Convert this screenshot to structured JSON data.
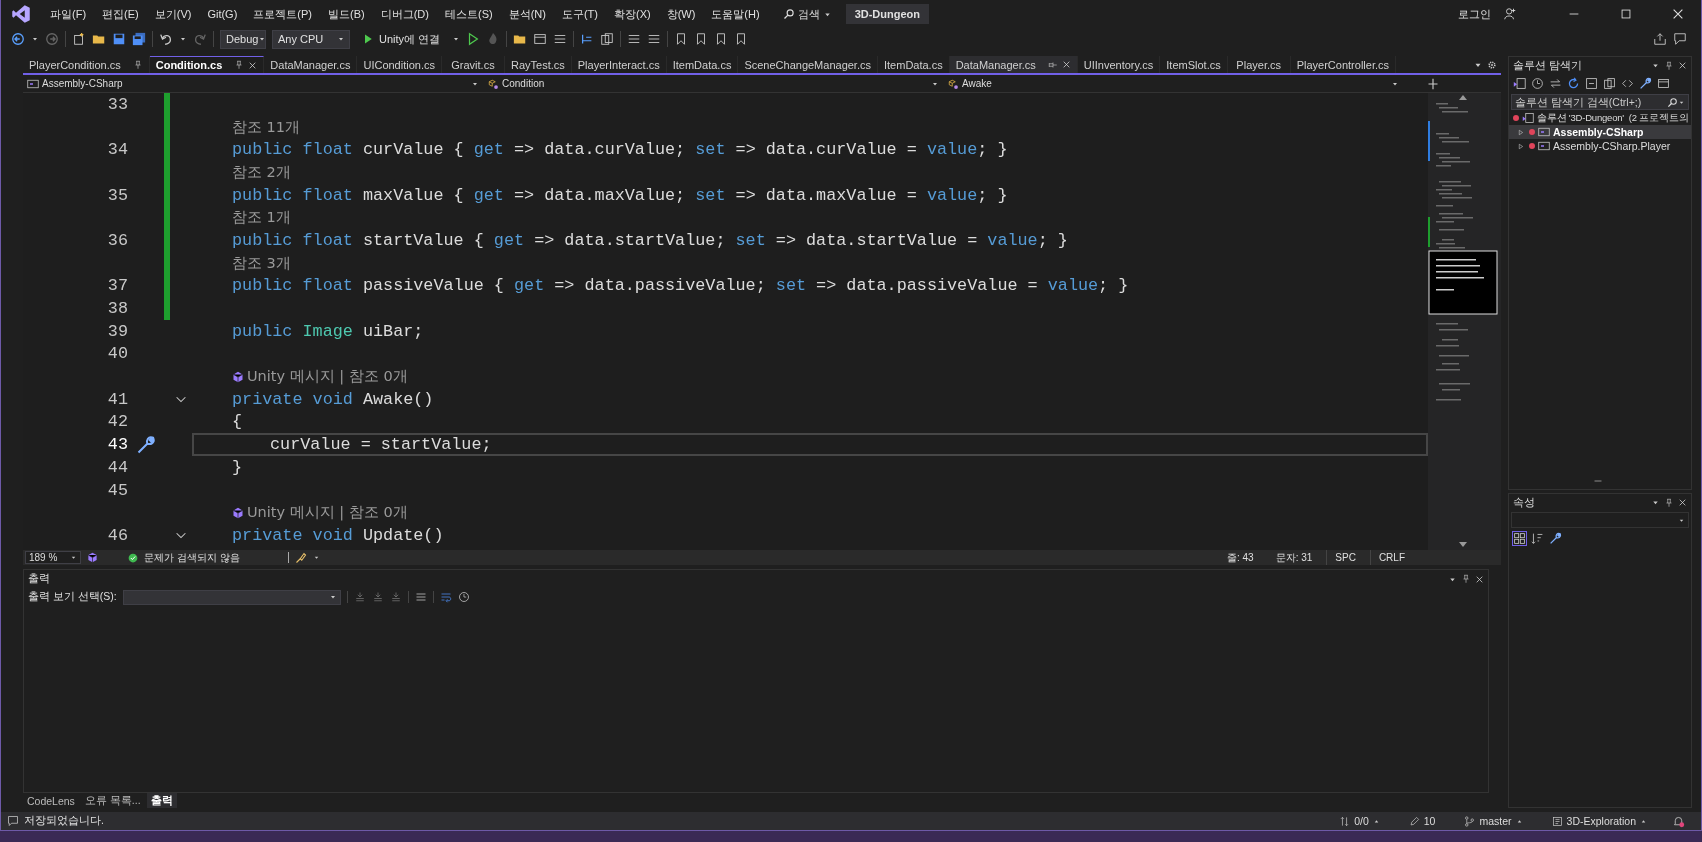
{
  "title_bar": {
    "menu": [
      "파일(F)",
      "편집(E)",
      "보기(V)",
      "Git(G)",
      "프로젝트(P)",
      "빌드(B)",
      "디버그(D)",
      "테스트(S)",
      "분석(N)",
      "도구(T)",
      "확장(X)",
      "창(W)",
      "도움말(H)"
    ],
    "search": "검색",
    "solution_name": "3D-Dungeon",
    "sign_in": "로그인"
  },
  "toolbar": {
    "configuration": "Debug",
    "platform": "Any CPU",
    "run_target": "Unity에 연결"
  },
  "document_tabs": [
    {
      "label": "PlayerCondition.cs",
      "selected": false,
      "pinned": true,
      "hovered": false
    },
    {
      "label": "Condition.cs",
      "selected": true,
      "pinned": true,
      "hovered": false
    },
    {
      "label": "DataManager.cs",
      "selected": false,
      "pinned": false,
      "hovered": false
    },
    {
      "label": "UICondition.cs",
      "selected": false,
      "pinned": false,
      "hovered": false
    },
    {
      "label": "Gravit.cs",
      "selected": false,
      "pinned": false,
      "hovered": false
    },
    {
      "label": "RayTest.cs",
      "selected": false,
      "pinned": false,
      "hovered": false
    },
    {
      "label": "PlayerInteract.cs",
      "selected": false,
      "pinned": false,
      "hovered": false
    },
    {
      "label": "ItemData.cs",
      "selected": false,
      "pinned": false,
      "hovered": false
    },
    {
      "label": "SceneChangeManager.cs",
      "selected": false,
      "pinned": false,
      "hovered": false
    },
    {
      "label": "ItemData.cs",
      "selected": false,
      "pinned": false,
      "hovered": false
    },
    {
      "label": "DataManager.cs",
      "selected": false,
      "pinned": false,
      "hovered": true
    },
    {
      "label": "UIInventory.cs",
      "selected": false,
      "pinned": false,
      "hovered": false
    },
    {
      "label": "ItemSlot.cs",
      "selected": false,
      "pinned": false,
      "hovered": false
    },
    {
      "label": "Player.cs",
      "selected": false,
      "pinned": false,
      "hovered": false
    },
    {
      "label": "PlayerController.cs",
      "selected": false,
      "pinned": false,
      "hovered": false
    }
  ],
  "navigation_bar": {
    "project": "Assembly-CSharp",
    "type": "Condition",
    "member": "Awake"
  },
  "code_lines": [
    {
      "kind": "code",
      "number": "33",
      "changed": true,
      "current": false,
      "foldable": false,
      "nested": false,
      "quick_action": false
    },
    {
      "kind": "codelens",
      "text": "참조 11개",
      "changed": true,
      "unity": false
    },
    {
      "kind": "code",
      "number": "34",
      "changed": true,
      "current": false,
      "foldable": false,
      "nested": false,
      "quick_action": false,
      "tokens": [
        {
          "kind": "keyword",
          "text": "public float "
        },
        {
          "kind": "plain",
          "text": "curValue { "
        },
        {
          "kind": "keyword",
          "text": "get"
        },
        {
          "kind": "plain",
          "text": " => data.curValue; "
        },
        {
          "kind": "keyword",
          "text": "set"
        },
        {
          "kind": "plain",
          "text": " => data.curValue = "
        },
        {
          "kind": "keyword",
          "text": "value"
        },
        {
          "kind": "plain",
          "text": "; }"
        }
      ]
    },
    {
      "kind": "codelens",
      "text": "참조 2개",
      "changed": true,
      "unity": false
    },
    {
      "kind": "code",
      "number": "35",
      "changed": true,
      "current": false,
      "foldable": false,
      "nested": false,
      "quick_action": false,
      "tokens": [
        {
          "kind": "keyword",
          "text": "public float "
        },
        {
          "kind": "plain",
          "text": "maxValue { "
        },
        {
          "kind": "keyword",
          "text": "get"
        },
        {
          "kind": "plain",
          "text": " => data.maxValue; "
        },
        {
          "kind": "keyword",
          "text": "set"
        },
        {
          "kind": "plain",
          "text": " => data.maxValue = "
        },
        {
          "kind": "keyword",
          "text": "value"
        },
        {
          "kind": "plain",
          "text": "; }"
        }
      ]
    },
    {
      "kind": "codelens",
      "text": "참조 1개",
      "changed": true,
      "unity": false
    },
    {
      "kind": "code",
      "number": "36",
      "changed": true,
      "current": false,
      "foldable": false,
      "nested": false,
      "quick_action": false,
      "tokens": [
        {
          "kind": "keyword",
          "text": "public float "
        },
        {
          "kind": "plain",
          "text": "startValue { "
        },
        {
          "kind": "keyword",
          "text": "get"
        },
        {
          "kind": "plain",
          "text": " => data.startValue; "
        },
        {
          "kind": "keyword",
          "text": "set"
        },
        {
          "kind": "plain",
          "text": " => data.startValue = "
        },
        {
          "kind": "keyword",
          "text": "value"
        },
        {
          "kind": "plain",
          "text": "; }"
        }
      ]
    },
    {
      "kind": "codelens",
      "text": "참조 3개",
      "changed": true,
      "unity": false
    },
    {
      "kind": "code",
      "number": "37",
      "changed": true,
      "current": false,
      "foldable": false,
      "nested": false,
      "quick_action": false,
      "tokens": [
        {
          "kind": "keyword",
          "text": "public float "
        },
        {
          "kind": "plain",
          "text": "passiveValue { "
        },
        {
          "kind": "keyword",
          "text": "get"
        },
        {
          "kind": "plain",
          "text": " => data.passiveValue; "
        },
        {
          "kind": "keyword",
          "text": "set"
        },
        {
          "kind": "plain",
          "text": " => data.passiveValue = "
        },
        {
          "kind": "keyword",
          "text": "value"
        },
        {
          "kind": "plain",
          "text": "; }"
        }
      ]
    },
    {
      "kind": "code",
      "number": "38",
      "changed": true,
      "current": false,
      "foldable": false,
      "nested": false,
      "quick_action": false
    },
    {
      "kind": "code",
      "number": "39",
      "changed": false,
      "current": false,
      "foldable": false,
      "nested": false,
      "quick_action": false,
      "tokens": [
        {
          "kind": "keyword",
          "text": "public "
        },
        {
          "kind": "type",
          "text": "Image"
        },
        {
          "kind": "plain",
          "text": " uiBar;"
        }
      ]
    },
    {
      "kind": "code",
      "number": "40",
      "changed": false,
      "current": false,
      "foldable": false,
      "nested": false,
      "quick_action": false
    },
    {
      "kind": "codelens",
      "text": "Unity 메시지 | 참조 0개",
      "changed": false,
      "unity": true
    },
    {
      "kind": "code",
      "number": "41",
      "changed": false,
      "current": false,
      "foldable": true,
      "nested": false,
      "quick_action": false,
      "tokens": [
        {
          "kind": "keyword",
          "text": "private void "
        },
        {
          "kind": "plain",
          "text": "Awake()"
        }
      ]
    },
    {
      "kind": "code",
      "number": "42",
      "changed": false,
      "current": false,
      "foldable": false,
      "nested": false,
      "quick_action": false,
      "tokens": [
        {
          "kind": "plain",
          "text": "{"
        }
      ]
    },
    {
      "kind": "code",
      "number": "43",
      "changed": false,
      "current": true,
      "foldable": false,
      "nested": true,
      "quick_action": true,
      "tokens": [
        {
          "kind": "plain",
          "text": "curValue = startValue;"
        }
      ]
    },
    {
      "kind": "code",
      "number": "44",
      "changed": false,
      "current": false,
      "foldable": false,
      "nested": false,
      "quick_action": false,
      "tokens": [
        {
          "kind": "plain",
          "text": "}"
        }
      ]
    },
    {
      "kind": "code",
      "number": "45",
      "changed": false,
      "current": false,
      "foldable": false,
      "nested": false,
      "quick_action": false
    },
    {
      "kind": "codelens",
      "text": "Unity 메시지 | 참조 0개",
      "changed": false,
      "unity": true
    },
    {
      "kind": "code",
      "number": "46",
      "changed": false,
      "current": false,
      "foldable": true,
      "nested": false,
      "quick_action": false,
      "tokens": [
        {
          "kind": "keyword",
          "text": "private void "
        },
        {
          "kind": "plain",
          "text": "Update()"
        }
      ]
    }
  ],
  "editor_status": {
    "zoom": "189 %",
    "issues": "문제가 검색되지 않음",
    "line": "줄: 43",
    "column": "문자: 31",
    "whitespace": "SPC",
    "line_ending": "CRLF"
  },
  "output_panel": {
    "title": "출력",
    "source_label": "출력 보기 선택(S):"
  },
  "bottom_tabs": [
    {
      "label": "CodeLens",
      "selected": false
    },
    {
      "label": "오류 목록...",
      "selected": false
    },
    {
      "label": "출력",
      "selected": true
    }
  ],
  "solution_explorer": {
    "title": "솔루션 탐색기",
    "search_placeholder": "솔루션 탐색기 검색(Ctrl+;)",
    "root": "솔루션 '3D-Dungeon'  (2 프로젝트의",
    "projects": [
      {
        "label": "Assembly-CSharp",
        "selected": true,
        "expanded": false
      },
      {
        "label": "Assembly-CSharp.Player",
        "selected": false,
        "expanded": false
      }
    ]
  },
  "properties_panel": {
    "title": "속성"
  },
  "status_bar": {
    "message": "저장되었습니다.",
    "changes": "0/0",
    "edits": "10",
    "branch": "master",
    "repository": "3D-Exploration"
  }
}
